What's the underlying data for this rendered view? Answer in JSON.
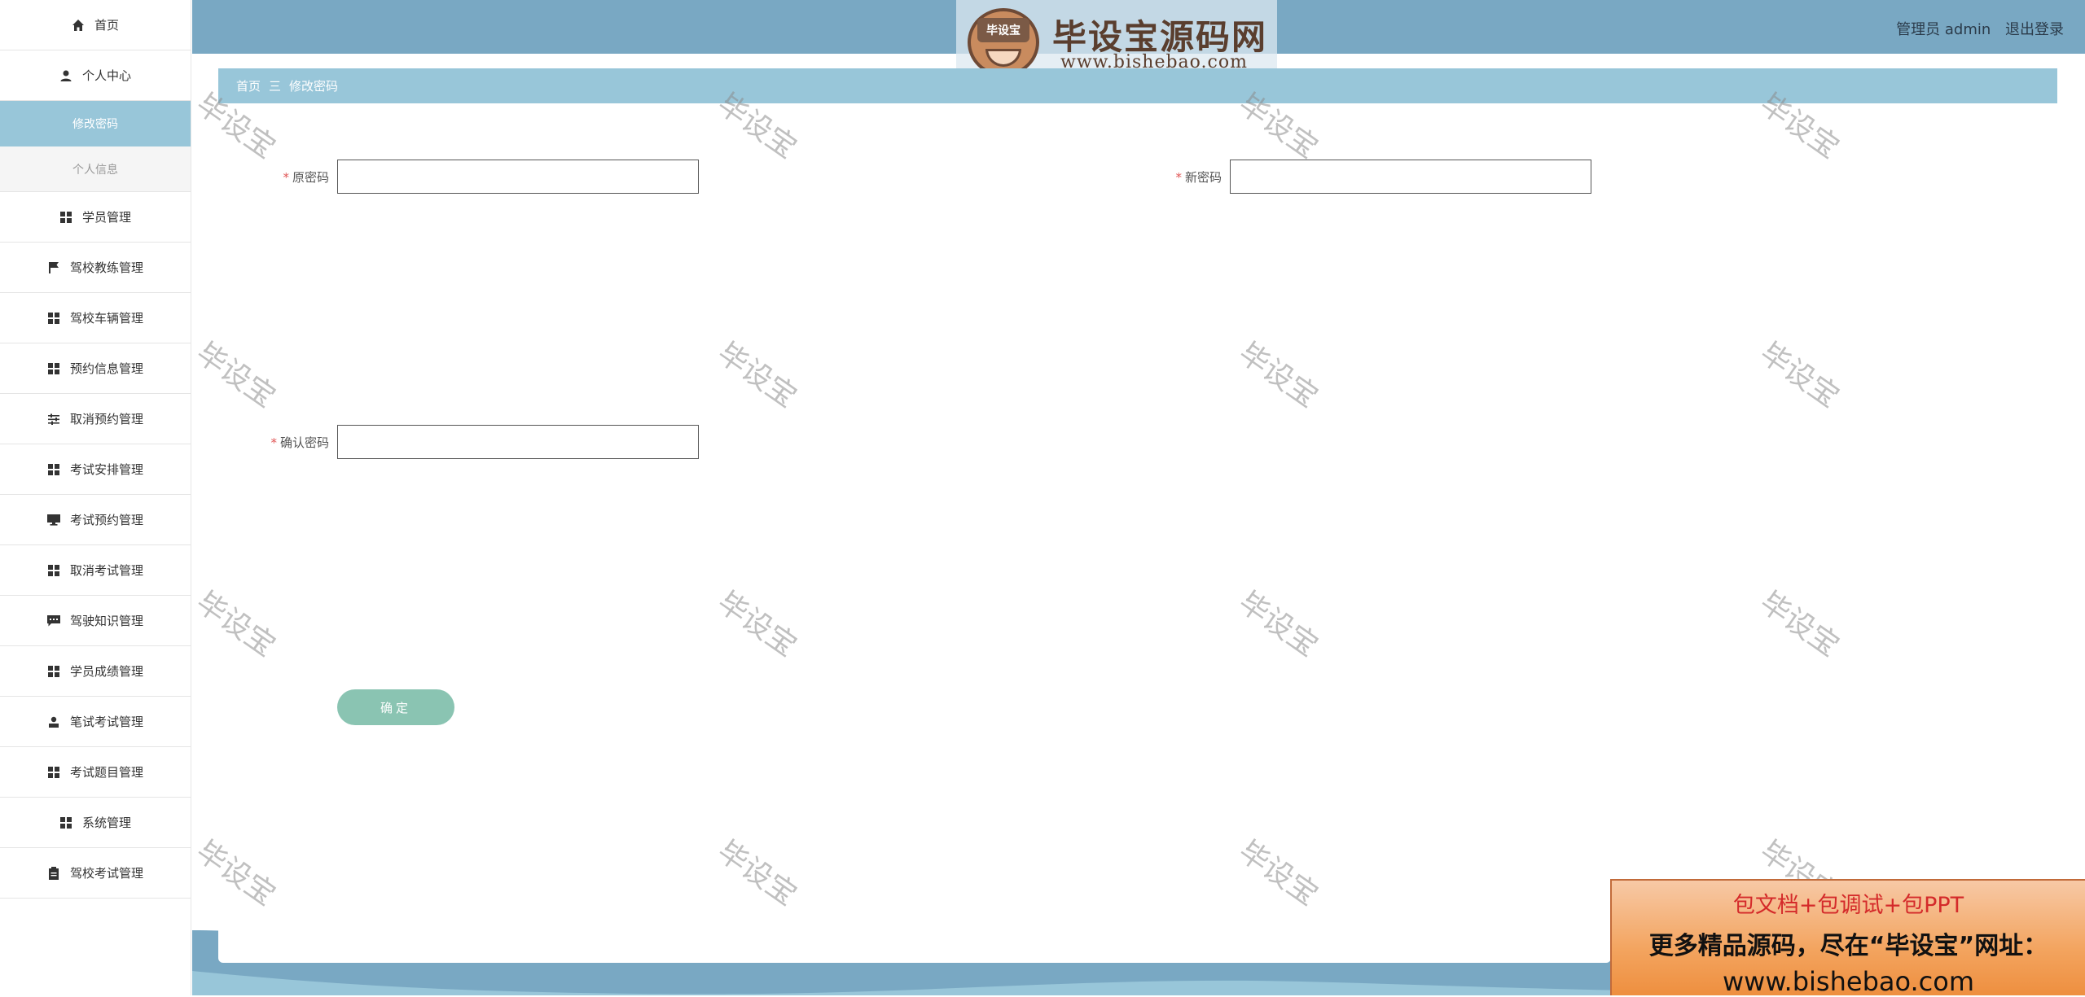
{
  "header": {
    "user_label": "管理员 admin",
    "logout_label": "退出登录"
  },
  "logo": {
    "badge": "毕设宝",
    "title": "毕设宝源码网",
    "url": "www.bishebao.com"
  },
  "sidebar": {
    "items": [
      {
        "label": "首页",
        "icon": "home-icon"
      },
      {
        "label": "个人中心",
        "icon": "user-icon"
      },
      {
        "label": "学员管理",
        "icon": "grid-icon"
      },
      {
        "label": "驾校教练管理",
        "icon": "flag-icon"
      },
      {
        "label": "驾校车辆管理",
        "icon": "grid-icon"
      },
      {
        "label": "预约信息管理",
        "icon": "grid-icon"
      },
      {
        "label": "取消预约管理",
        "icon": "sliders-icon"
      },
      {
        "label": "考试安排管理",
        "icon": "grid-icon"
      },
      {
        "label": "考试预约管理",
        "icon": "monitor-icon"
      },
      {
        "label": "取消考试管理",
        "icon": "grid-icon"
      },
      {
        "label": "驾驶知识管理",
        "icon": "chat-icon"
      },
      {
        "label": "学员成绩管理",
        "icon": "grid-icon"
      },
      {
        "label": "笔试考试管理",
        "icon": "person-icon"
      },
      {
        "label": "考试题目管理",
        "icon": "grid-icon"
      },
      {
        "label": "系统管理",
        "icon": "grid-icon"
      },
      {
        "label": "驾校考试管理",
        "icon": "clipboard-icon"
      }
    ],
    "subitems": {
      "change_password": "修改密码",
      "personal_info": "个人信息"
    }
  },
  "breadcrumb": {
    "home": "首页",
    "separator": "三",
    "current": "修改密码"
  },
  "form": {
    "required_mark": "*",
    "old_password_label": "原密码",
    "new_password_label": "新密码",
    "confirm_password_label": "确认密码",
    "old_password_value": "",
    "new_password_value": "",
    "confirm_password_value": "",
    "submit_label": "确定"
  },
  "watermark": "毕设宝",
  "ad": {
    "line1": "包文档+包调试+包PPT",
    "line2": "更多精品源码，尽在“毕设宝”网址：",
    "line3": "www.bishebao.com"
  },
  "colors": {
    "header": "#79a8c3",
    "accent": "#98c6d9",
    "button": "#8ac4b2"
  }
}
